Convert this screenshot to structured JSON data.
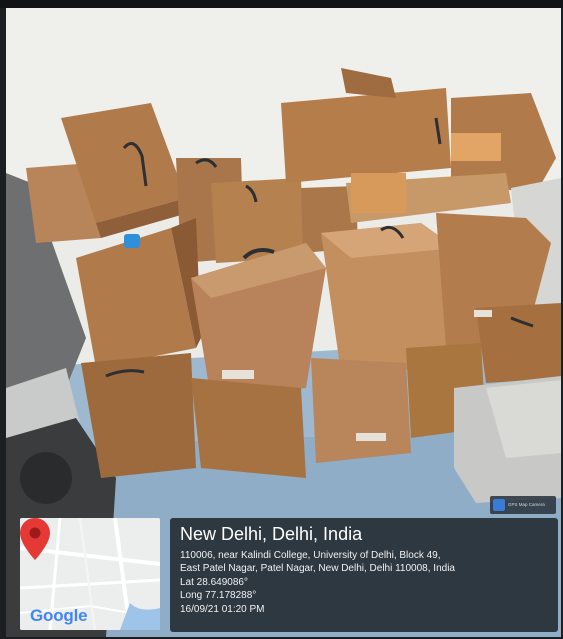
{
  "location": {
    "title": "New Delhi, Delhi, India",
    "address_line1": "110006, near Kalindi College, University of Delhi, Block 49,",
    "address_line2": "East Patel Nagar, Patel Nagar, New Delhi, Delhi 110008, India",
    "lat": "Lat 28.649086°",
    "long": "Long 77.178288°",
    "datetime": "16/09/21 01:20 PM"
  },
  "map": {
    "brand": "Google",
    "pin_color": "#e53935",
    "road_color": "#ffffff",
    "water_color": "#9fc4ea"
  },
  "camera_badge": {
    "label": "GPS Map Camera"
  },
  "colors": {
    "box_wood": "#b07a4a",
    "wall": "#ebebe8",
    "floor": "#9db8cf",
    "panel_bg": "#1e242a"
  }
}
